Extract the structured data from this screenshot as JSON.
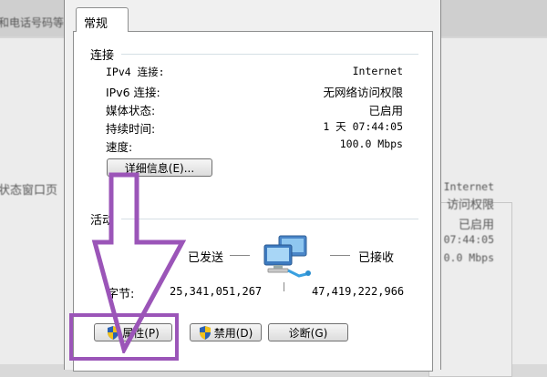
{
  "background": {
    "top_text": "和电话号码等",
    "left_text": "状态窗口页",
    "right_values": [
      "Internet",
      "访问权限",
      "已启用",
      "07:44:05",
      "0.0 Mbps"
    ]
  },
  "dialog": {
    "tab_label": "常规",
    "connection": {
      "title": "连接",
      "rows": [
        {
          "label": "IPv4 连接:",
          "value": "Internet"
        },
        {
          "label": "IPv6 连接:",
          "value": "无网络访问权限"
        },
        {
          "label": "媒体状态:",
          "value": "已启用"
        },
        {
          "label": "持续时间:",
          "value": "1 天 07:44:05"
        },
        {
          "label": "速度:",
          "value": "100.0 Mbps"
        }
      ],
      "details_button": "详细信息(E)..."
    },
    "activity": {
      "title": "活动",
      "sent_label": "已发送",
      "received_label": "已接收",
      "bytes_label": "字节:",
      "bytes_sent": "25,341,051,267",
      "bytes_received": "47,419,222,966"
    },
    "buttons": {
      "properties": "属性(P)",
      "disable": "禁用(D)",
      "diagnose": "诊断(G)"
    }
  },
  "colors": {
    "annotation": "#9b55b8"
  }
}
